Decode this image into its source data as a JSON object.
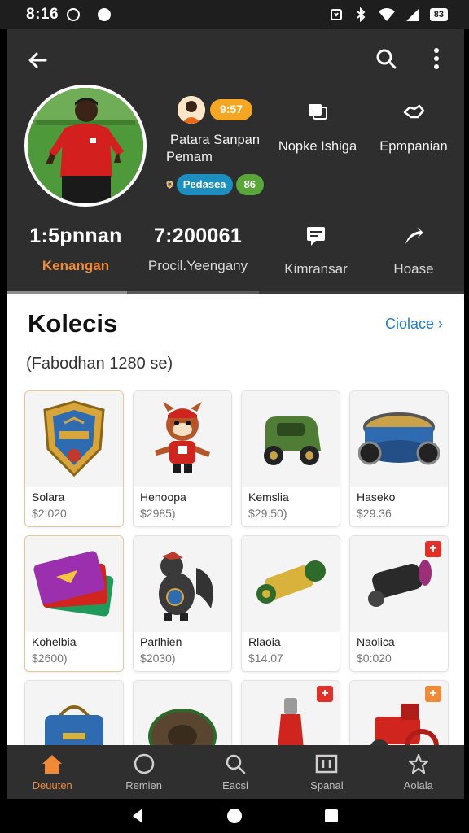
{
  "status_bar": {
    "time": "8:16",
    "battery": "83"
  },
  "profile": {
    "info_col1": {
      "badge": "9:57",
      "line1": "Patara Sanpan",
      "line2": "Pemam",
      "pill1": "Pedasea",
      "pill2": "86"
    },
    "info_col2": {
      "label": "Nopke Ishiga"
    },
    "info_col3": {
      "label": "Epmpanian"
    }
  },
  "stats": [
    {
      "value": "1:5pnnan",
      "label": "Kenangan"
    },
    {
      "value": "7:200061",
      "label": "Procil.Yeengany"
    },
    {
      "value": "",
      "label": "Kimransar"
    },
    {
      "value": "",
      "label": "Hoase"
    }
  ],
  "collection": {
    "title": "Kolecis",
    "see_all": "Ciolace",
    "subtitle": "(Fabodhan 1280 se)",
    "items": [
      {
        "name": "Solara",
        "price": "$2:020"
      },
      {
        "name": "Henoopa",
        "price": "$2985)"
      },
      {
        "name": "Kemslia",
        "price": "$29.50)"
      },
      {
        "name": "Haseko",
        "price": "$29.36"
      },
      {
        "name": "Kohelbia",
        "price": "$2600)"
      },
      {
        "name": "Parlhien",
        "price": "$2030)"
      },
      {
        "name": "Rlaoia",
        "price": "$14.07"
      },
      {
        "name": "Naolica",
        "price": "$0:020"
      },
      {
        "name": "",
        "price": ""
      },
      {
        "name": "",
        "price": ""
      },
      {
        "name": "",
        "price": ""
      },
      {
        "name": "",
        "price": ""
      }
    ]
  },
  "bottom_nav": [
    {
      "label": "Deuuten"
    },
    {
      "label": "Remien"
    },
    {
      "label": "Eacsi"
    },
    {
      "label": "Spanal"
    },
    {
      "label": "Aolala"
    }
  ],
  "colors": {
    "header_bg": "#2e2e2e",
    "accent_orange": "#f08a36",
    "link_blue": "#1e7fc7",
    "badge_yellow": "#f5a623",
    "pill_blue": "#1d8fbf",
    "pill_green": "#5aa63a",
    "badge_red": "#e0302a"
  },
  "icons": [
    "back-arrow-icon",
    "search-icon",
    "more-vert-icon",
    "chat-icon",
    "handshake-icon",
    "message-icon",
    "share-icon",
    "home-icon",
    "circle-icon",
    "search-icon",
    "panel-icon",
    "star-icon"
  ]
}
